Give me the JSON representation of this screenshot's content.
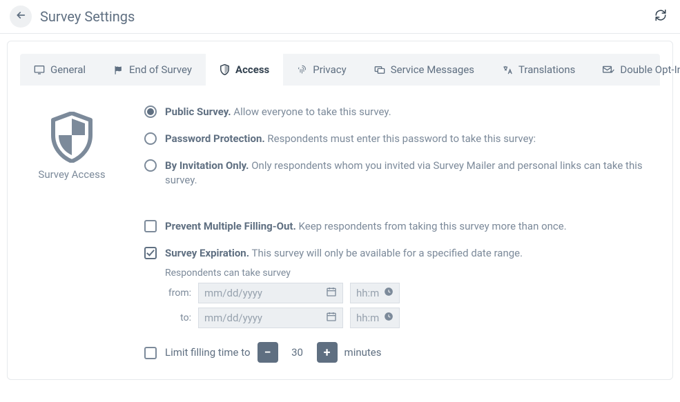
{
  "header": {
    "title": "Survey Settings"
  },
  "tabs": {
    "general": "General",
    "end_of_survey": "End of Survey",
    "access": "Access",
    "privacy": "Privacy",
    "service_messages": "Service Messages",
    "translations": "Translations",
    "double_opt_in": "Double Opt-In"
  },
  "section_label": "Survey Access",
  "options": {
    "public": {
      "title": "Public Survey.",
      "desc": " Allow everyone to take this survey."
    },
    "password": {
      "title": "Password Protection.",
      "desc": " Respondents must enter this password to take this survey:"
    },
    "invitation": {
      "title": "By Invitation Only.",
      "desc": " Only respondents whom you invited via Survey Mailer and personal links can take this survey."
    },
    "prevent_multiple": {
      "title": "Prevent Multiple Filling-Out.",
      "desc": " Keep respondents from taking this survey more than once."
    },
    "expiration": {
      "title": "Survey Expiration.",
      "desc": " This survey will only be available for a specified date range."
    }
  },
  "expiration": {
    "sublabel": "Respondents can take survey",
    "from_label": "from:",
    "to_label": "to:",
    "date_placeholder": "mm/dd/yyyy",
    "time_placeholder": "hh:mm"
  },
  "limit": {
    "label": "Limit filling time to",
    "value": "30",
    "unit": "minutes"
  }
}
